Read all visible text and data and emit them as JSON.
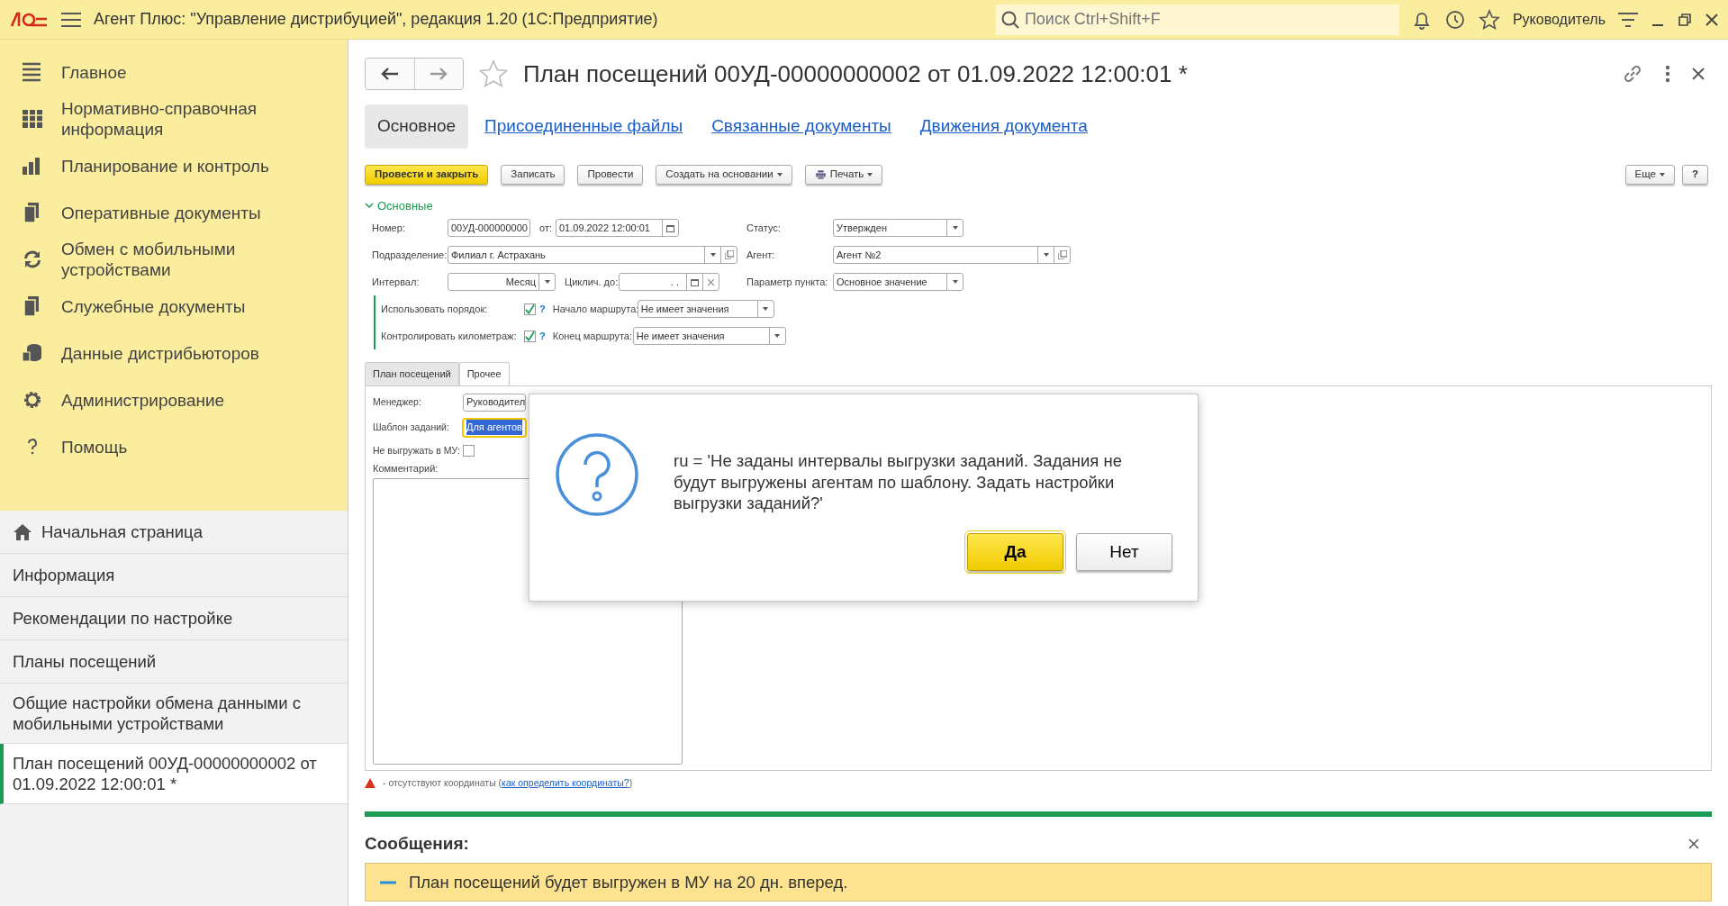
{
  "app_bar": {
    "title": "Агент Плюс: \"Управление дистрибуцией\", редакция 1.20  (1С:Предприятие)",
    "search": {
      "placeholder": "Поиск Ctrl+Shift+F"
    },
    "user": "Руководитель"
  },
  "sidebar": {
    "sections": [
      {
        "label": "Главное",
        "kind": "menu"
      },
      {
        "label": "Нормативно-справочная информация",
        "kind": "catalog"
      },
      {
        "label": "Планирование и контроль",
        "kind": "chart"
      },
      {
        "label": "Оперативные документы",
        "kind": "docs"
      },
      {
        "label": "Обмен с мобильными устройствами",
        "kind": "sync"
      },
      {
        "label": "Служебные документы",
        "kind": "docs"
      },
      {
        "label": "Данные дистрибьюторов",
        "kind": "data"
      },
      {
        "label": "Администрирование",
        "kind": "gear"
      },
      {
        "label": "Помощь",
        "kind": "help"
      }
    ],
    "open_windows": [
      {
        "label": "Начальная страница",
        "kind": "home",
        "selected": false
      },
      {
        "label": "Информация",
        "kind": "plain",
        "selected": false
      },
      {
        "label": "Рекомендации по настройке",
        "kind": "plain",
        "selected": false
      },
      {
        "label": "Планы посещений",
        "kind": "plain",
        "selected": false
      },
      {
        "label": "Общие настройки обмена данными с мобильными устройствами",
        "kind": "plain",
        "selected": false
      },
      {
        "label": "План посещений 00УД-00000000002 от 01.09.2022 12:00:01 *",
        "kind": "plain",
        "selected": true
      }
    ]
  },
  "form": {
    "title": "План посещений 00УД-00000000002 от 01.09.2022 12:00:01 *",
    "tabs": [
      {
        "label": "Основное",
        "selected": true
      },
      {
        "label": "Присоединенные файлы",
        "selected": false
      },
      {
        "label": "Связанные документы",
        "selected": false
      },
      {
        "label": "Движения документа",
        "selected": false
      }
    ],
    "toolbar": [
      {
        "label": "Провести и закрыть",
        "kind": "default"
      },
      {
        "label": "Записать",
        "kind": "plain"
      },
      {
        "label": "Провести",
        "kind": "plain"
      },
      {
        "label": "Создать на основании",
        "kind": "menu"
      },
      {
        "label": "Печать",
        "kind": "print"
      }
    ],
    "more_button": "Еще",
    "help_button": "?",
    "group": {
      "title": "Основные",
      "expanded": true
    },
    "number": {
      "label": "Номер:",
      "value": "00УД-000000000"
    },
    "date": {
      "label": "от:",
      "value": "01.09.2022 12:00:01"
    },
    "status": {
      "label": "Статус:",
      "value": "Утвержден"
    },
    "division": {
      "label": "Подразделение:",
      "value": "Филиал г. Астрахань"
    },
    "agent": {
      "label": "Агент:",
      "value": "Агент №2"
    },
    "interval": {
      "label": "Интервал:",
      "value": "Месяц"
    },
    "cyclic_until": {
      "label": "Циклич. до:",
      "value": ". ."
    },
    "point_param": {
      "label": "Параметр пункта:",
      "value": "Основное значение"
    },
    "use_order": {
      "label": "Использовать порядок:",
      "checked": true,
      "help": "?"
    },
    "route_start": {
      "label": "Начало маршрута:",
      "value": "Не имеет значения"
    },
    "control_mileage": {
      "label": "Контролировать километраж:",
      "checked": true,
      "help": "?"
    },
    "route_end": {
      "label": "Конец маршрута:",
      "value": "Не имеет значения"
    },
    "inner_tabs": [
      {
        "label": "План посещений",
        "selected": false
      },
      {
        "label": "Прочее",
        "selected": true
      }
    ],
    "manager": {
      "label": "Менеджер:",
      "value": "Руководител"
    },
    "task_template": {
      "label": "Шаблон заданий:",
      "value": "Для агентов",
      "focused": true
    },
    "no_upload": {
      "label": "Не выгружать в МУ:",
      "checked": false
    },
    "comment": {
      "label": "Комментарий:"
    },
    "legend": {
      "text": "- отсутствуют координаты (",
      "link": "как определить координаты?",
      "tail": ")"
    }
  },
  "messages": {
    "title": "Сообщения:",
    "items": [
      {
        "text": "План посещений будет выгружен в МУ на 20 дн. вперед."
      }
    ]
  },
  "dialog": {
    "message": "ru = 'Не заданы интервалы выгрузки заданий. Задания не будут выгружены агентам по шаблону. Задать настройки выгрузки заданий?'",
    "buttons": [
      {
        "label": "Да",
        "default": true
      },
      {
        "label": "Нет",
        "default": false
      }
    ]
  }
}
